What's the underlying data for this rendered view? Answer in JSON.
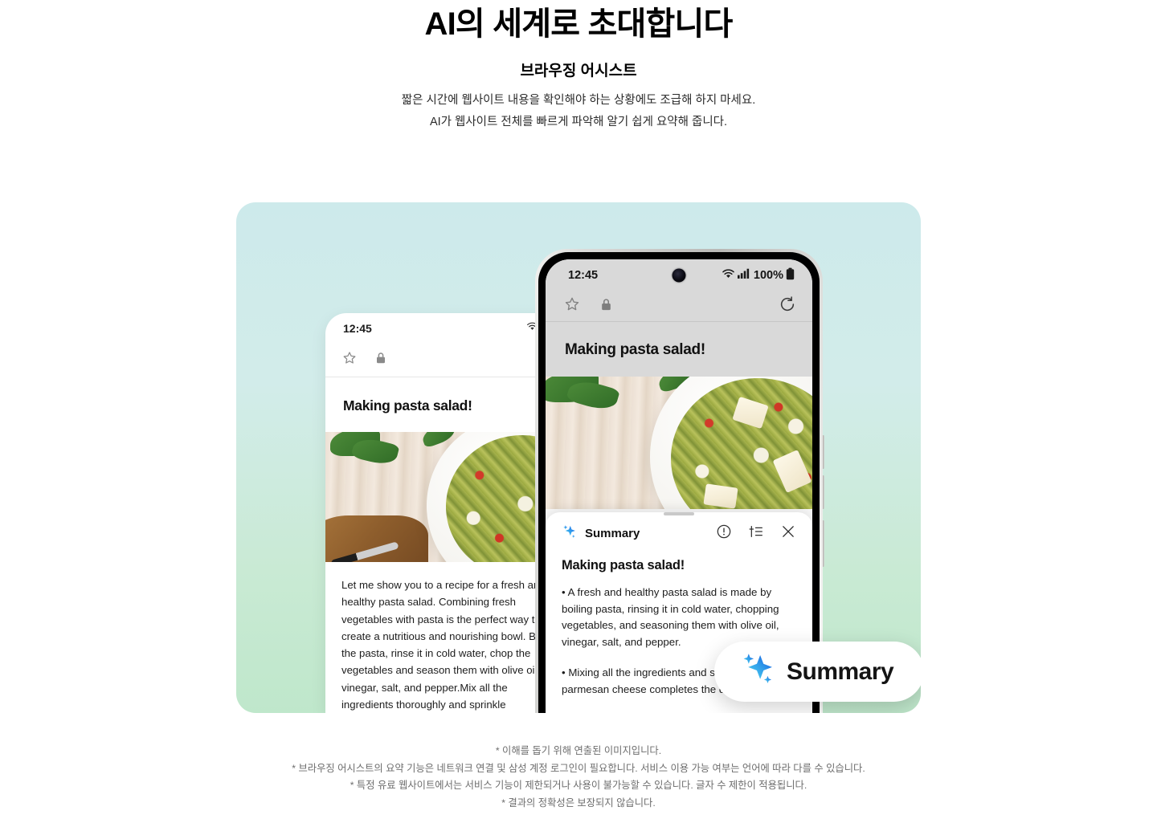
{
  "header": {
    "title": "AI의 세계로 초대합니다",
    "subtitle": "브라우징 어시스트",
    "desc_line1": "짧은 시간에 웹사이트 내용을 확인해야 하는 상황에도 조급해 하지 마세요.",
    "desc_line2": "AI가 웹사이트 전체를 빠르게 파악해 알기 쉽게 요약해 줍니다."
  },
  "pill": {
    "label": "Summary",
    "icon": "sparkle-icon"
  },
  "left_phone": {
    "status": {
      "time": "12:45",
      "wifi_icon": "wifi-icon",
      "signal_icon": "signal-icon"
    },
    "toolbar": {
      "bookmark_icon": "star-icon",
      "lock_icon": "lock-icon"
    },
    "page_title": "Making pasta salad!",
    "body": "Let me show you to a recipe for a fresh and healthy pasta salad. Combining fresh vegetables with pasta is the perfect way to create a nutritious and nourishing bowl. Boil the pasta, rinse it in cold water, chop the vegetables and season them with olive oil, vinegar, salt, and pepper.Mix all the ingredients thoroughly and sprinkle parmesan cheese to complete the dish. Enjoy simple, healthy pasta!"
  },
  "right_phone": {
    "status": {
      "time": "12:45",
      "wifi_icon": "wifi-icon",
      "signal_icon": "signal-icon",
      "battery_text": "100%",
      "battery_icon": "battery-full-icon"
    },
    "toolbar": {
      "bookmark_icon": "star-icon",
      "lock_icon": "lock-icon",
      "refresh_icon": "refresh-icon"
    },
    "page_title": "Making pasta salad!",
    "summary_sheet": {
      "label": "Summary",
      "sparkle_icon": "sparkle-icon",
      "info_icon": "info-circle-icon",
      "tune_icon": "tune-list-icon",
      "close_icon": "close-icon",
      "title": "Making pasta salad!",
      "bullets": [
        "• A fresh and healthy pasta salad is made by boiling pasta, rinsing it in cold water, chopping vegetables, and seasoning them with olive oil, vinegar, salt, and pepper.",
        "• Mixing all the ingredients and sprinkling parmesan cheese completes the dish."
      ]
    }
  },
  "footer": {
    "line1": "* 이해를 돕기 위해 연출된 이미지입니다.",
    "line2": "* 브라우징 어시스트의 요약 기능은 네트워크 연결 및 삼성 계정 로그인이 필요합니다. 서비스 이용 가능 여부는 언어에 따라 다를 수 있습니다.",
    "line3": "* 특정 유료 웹사이트에서는 서비스 기능이 제한되거나 사용이 불가능할 수 있습니다. 글자 수 제한이 적용됩니다.",
    "line4": "* 결과의 정확성은 보장되지 않습니다."
  },
  "colors": {
    "hero_top": "#cdeaeb",
    "hero_bottom": "#bfe7cb",
    "sparkle_blue": "#1a73e8",
    "sparkle_cyan": "#45d2f0",
    "text_dark": "#111111",
    "footer_grey": "#6d6d6d"
  }
}
